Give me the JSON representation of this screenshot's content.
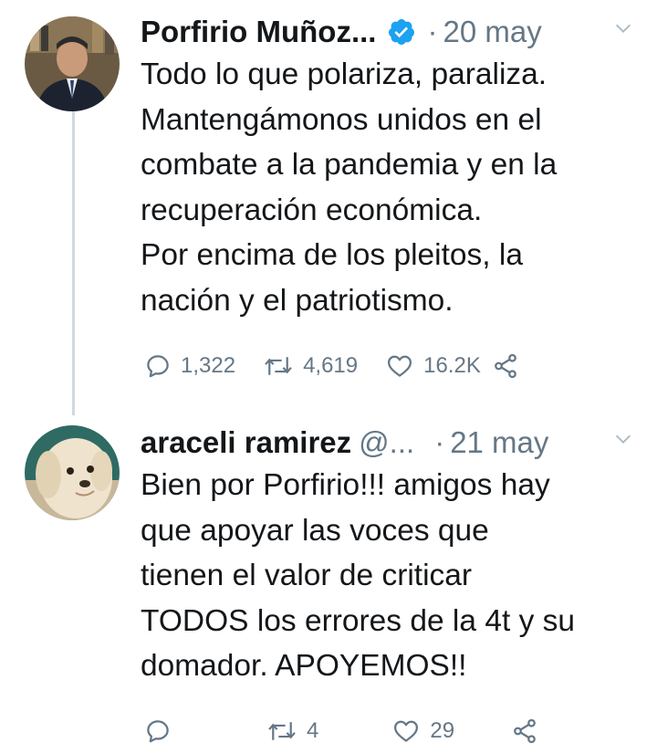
{
  "colors": {
    "text": "#14171a",
    "secondary": "#657786",
    "verified": "#1da1f2",
    "thread_line": "#cfd9de"
  },
  "tweets": [
    {
      "author_name": "Porfirio Muñoz...",
      "handle": "",
      "verified": true,
      "separator": "·",
      "date": "20 may",
      "text": "Todo lo que polariza, paraliza.\nMantengámonos unidos en el\ncombate a la pandemia y en la\nrecuperación económica.\nPor encima de los pleitos, la\nnación y el patriotismo.",
      "replies": "1,322",
      "retweets": "4,619",
      "likes": "16.2K",
      "icons": [
        "reply-icon",
        "retweet-icon",
        "like-icon",
        "share-icon",
        "chevron-down-icon",
        "verified-icon"
      ]
    },
    {
      "author_name": "araceli ramirez",
      "handle": "@...",
      "verified": false,
      "separator": "·",
      "date": "21 may",
      "text": "Bien por Porfirio!!! amigos hay\nque apoyar las voces que\ntienen el valor de criticar\nTODOS los errores de la 4t y su\ndomador. APOYEMOS!!",
      "replies": "",
      "retweets": "4",
      "likes": "29",
      "icons": [
        "reply-icon",
        "retweet-icon",
        "like-icon",
        "share-icon",
        "chevron-down-icon"
      ]
    }
  ]
}
